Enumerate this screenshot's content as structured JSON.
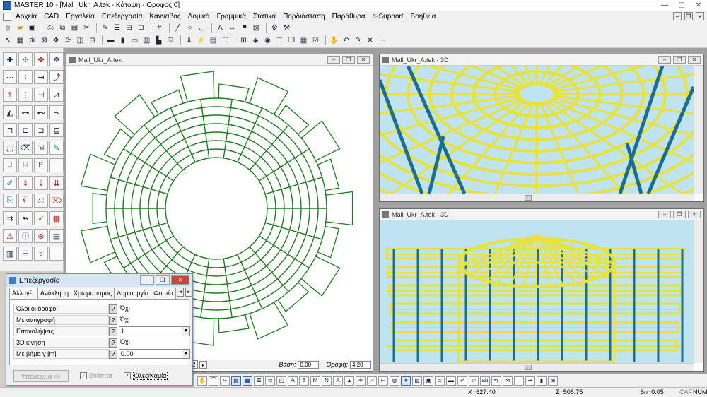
{
  "app": {
    "title": "MASTER 10 - [Mall_Ukr_A.tek - Κάτοψη - Οροφος 0]"
  },
  "menu": [
    "Αρχεία",
    "CAD",
    "Εργαλεία",
    "Επεξεργασία",
    "Κάνναβος",
    "Δομικά",
    "Γραμμικά",
    "Στατικά",
    "Πορδιάσταση",
    "Παράθυρα",
    "e-Support",
    "Βοήθεια"
  ],
  "windows": {
    "plan": {
      "title": "Mall_Ukr_A.tek"
    },
    "view3d_top": {
      "title": "Mall_Ukr_A.tek - 3D"
    },
    "view3d_bottom": {
      "title": "Mall_Ukr_A.tek - 3D"
    }
  },
  "plan_status": {
    "floor_tab": "οφ.2",
    "base_label": "Βάση:",
    "base_value": "0.00",
    "ceiling_label": "Οροφή:",
    "ceiling_value": "4.20"
  },
  "dialog": {
    "title": "Επεξεργασία",
    "tabs": [
      "Αλλαγές",
      "Ανάκληση",
      "Χρωματισμός",
      "Δημιουργία",
      "Φορτία"
    ],
    "rows": [
      {
        "label": "Όλοι οι όροφοι",
        "value": "Όχι",
        "kind": "text"
      },
      {
        "label": "Με αντιγραφή",
        "value": "Όχι",
        "kind": "text"
      },
      {
        "label": "Επανολήψεις",
        "value": "1",
        "kind": "dropdown"
      },
      {
        "label": "3D κίνηση",
        "value": "Όχι",
        "kind": "text"
      },
      {
        "label": "Με βήμα y [m]",
        "value": "0.00",
        "kind": "dropdown"
      }
    ],
    "example_button": "Υπόδειγμα >>",
    "unity_checkbox": "Ενότητα",
    "all_checkbox": "Όλες/Καμία"
  },
  "status": {
    "x": "X=627.40",
    "z": "Z=505.75",
    "sn": "Sn=0.05",
    "caf": "CAF",
    "num": "NUM"
  },
  "colors": {
    "plan_lines": "#1f7a1f",
    "sky": "#bfe3ef",
    "beam_yellow": "#e8e23a",
    "column_teal": "#1e6f8f"
  }
}
